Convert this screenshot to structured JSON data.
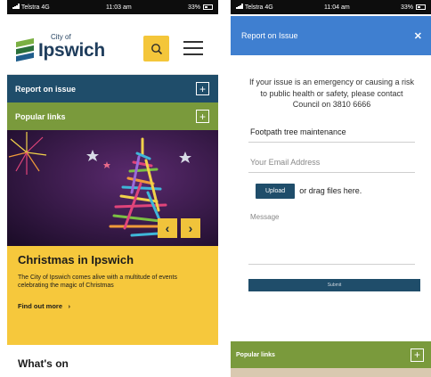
{
  "left_screen": {
    "status": {
      "carrier": "Telstra 4G",
      "time": "11:03 am",
      "battery": "33%"
    },
    "header": {
      "logo_small": "City of",
      "logo_big": "Ipswich"
    },
    "report_bar": {
      "label": "Report on issue",
      "icon": "plus-icon"
    },
    "popular_bar": {
      "label": "Popular links",
      "icon": "plus-icon"
    },
    "promo": {
      "title": "Christmas in Ipswich",
      "body": "The City of Ipswich comes alive with a multitude of events celebrating the magic of Christmas",
      "link": "Find out more"
    },
    "section_title": "What's on"
  },
  "right_screen": {
    "status": {
      "carrier": "Telstra 4G",
      "time": "11:04 am",
      "battery": "33%"
    },
    "modal": {
      "title": "Report on Issue",
      "close_icon": "close-icon",
      "notice": "If your issue is an emergency or causing a risk to public health or safety, please contact Council on  3810 6666",
      "subject_value": "Footpath tree maintenance",
      "email_placeholder": "Your Email Address",
      "upload_label": "Upload",
      "drag_text": "or drag files here.",
      "message_placeholder": "Message",
      "submit_label": "Submit"
    },
    "popular_bar": {
      "label": "Popular links",
      "icon": "plus-icon"
    }
  },
  "colors": {
    "navy": "#1f4d6a",
    "green": "#7a9a3c",
    "yellow": "#f6c83c",
    "modal_blue": "#3f7fd0"
  }
}
